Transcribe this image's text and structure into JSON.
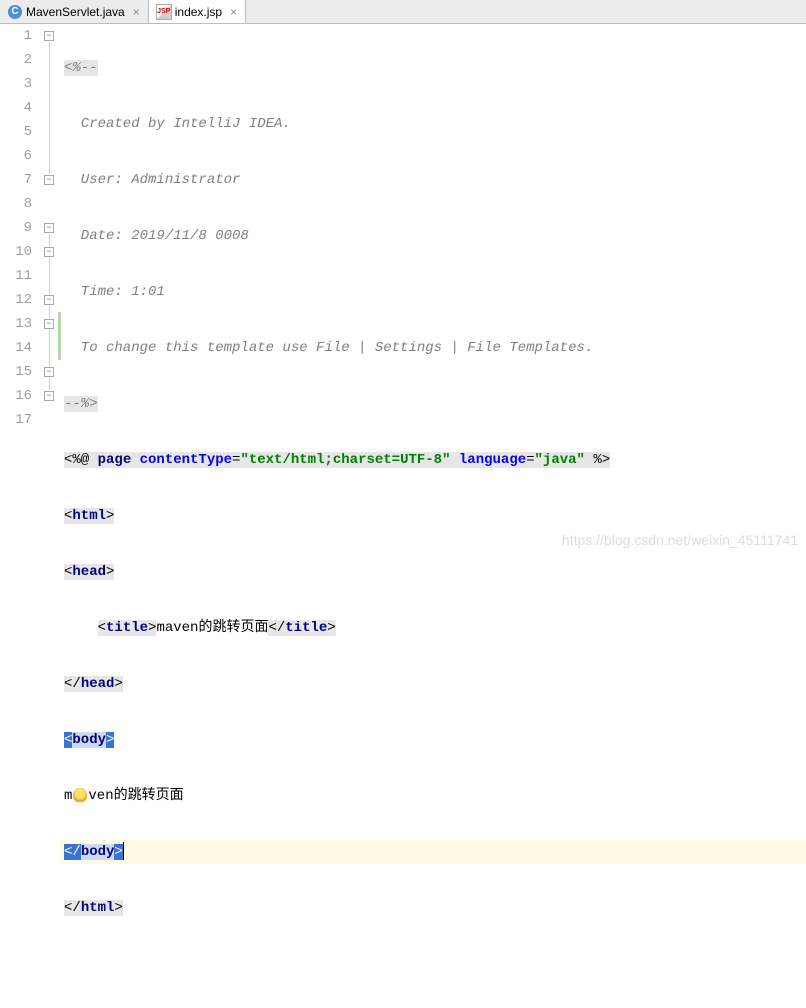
{
  "tabs": [
    {
      "label": "MavenServlet.java",
      "active": false
    },
    {
      "label": "index.jsp",
      "active": true
    }
  ],
  "lines": {
    "l1": {
      "n": "1",
      "indent": "",
      "comment_open": "<%--"
    },
    "l2": {
      "n": "2",
      "text": "  Created by IntelliJ IDEA."
    },
    "l3": {
      "n": "3",
      "text": "  User: Administrator"
    },
    "l4": {
      "n": "4",
      "text": "  Date: 2019/11/8 0008"
    },
    "l5": {
      "n": "5",
      "text": "  Time: 1:01"
    },
    "l6": {
      "n": "6",
      "text": "  To change this template use File | Settings | File Templates."
    },
    "l7": {
      "n": "7",
      "comment_close": "--%>"
    },
    "l8": {
      "n": "8",
      "raw": {
        "open": "<%@ ",
        "kw": "page",
        "a1": "contentType",
        "v1": "\"text/html;charset=UTF-8\"",
        "a2": "language",
        "v2": "\"java\"",
        "close": " %>"
      }
    },
    "l9": {
      "n": "9",
      "tag": "html",
      "kind": "open"
    },
    "l10": {
      "n": "10",
      "tag": "head",
      "kind": "open"
    },
    "l11": {
      "n": "11",
      "indent": "    ",
      "tagopen": "title",
      "inner": "maven的跳转页面",
      "tagclose": "title"
    },
    "l12": {
      "n": "12",
      "tag": "head",
      "kind": "close"
    },
    "l13": {
      "n": "13",
      "tag": "body",
      "kind": "open",
      "highlight": true
    },
    "l14": {
      "n": "14",
      "body_prefix": "m",
      "body_rest": "ven的跳转页面"
    },
    "l15": {
      "n": "15",
      "tag": "body",
      "kind": "close",
      "highlight": true,
      "cursor": true
    },
    "l16": {
      "n": "16",
      "tag": "html",
      "kind": "close"
    },
    "l17": {
      "n": "17"
    }
  },
  "watermark": "https://blog.csdn.net/weixin_45111741"
}
